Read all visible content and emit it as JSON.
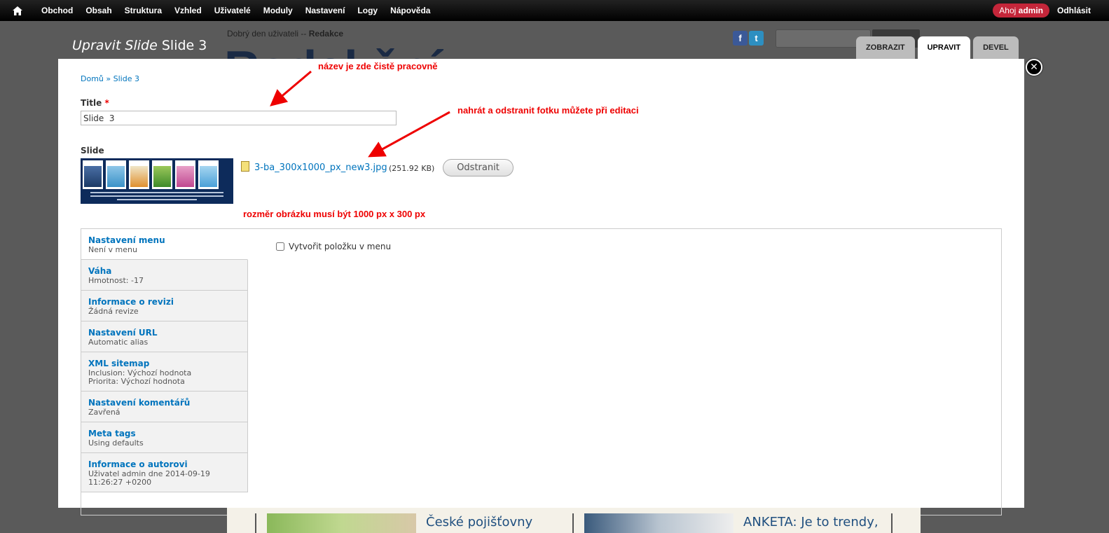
{
  "toolbar": {
    "menu": [
      "Obchod",
      "Obsah",
      "Struktura",
      "Vzhled",
      "Uživatelé",
      "Moduly",
      "Nastavení",
      "Logy",
      "Nápověda"
    ],
    "hello_prefix": "Ahoj",
    "hello_user": "admin",
    "logout": "Odhlásit"
  },
  "background_page": {
    "greeting_prefix": "Dobrý den uživateli --",
    "greeting_user": "Redakce",
    "big_text": "Redakční",
    "bottom_headlines": [
      "České pojišťovny",
      "ANKETA: Je to trendy,"
    ]
  },
  "overlay": {
    "title_italic": "Upravit Slide",
    "title_rest": "Slide 3",
    "tabs": [
      "ZOBRAZIT",
      "UPRAVIT",
      "DEVEL"
    ],
    "breadcrumb": {
      "home": "Domů",
      "separator": "»",
      "current": "Slide 3"
    },
    "title_label": "Title",
    "required_mark": "*",
    "title_value": "Slide  3",
    "slide_label": "Slide",
    "file_name": "3-ba_300x1000_px_new3.jpg",
    "file_size": "(251.92 KB)",
    "remove_button": "Odstranit",
    "vertical_tabs": [
      {
        "title": "Nastavení menu",
        "summary": "Není v menu"
      },
      {
        "title": "Váha",
        "summary": "Hmotnost: -17"
      },
      {
        "title": "Informace o revizi",
        "summary": "Žádná revize"
      },
      {
        "title": "Nastavení URL",
        "summary": "Automatic alias"
      },
      {
        "title": "XML sitemap",
        "summary": "Inclusion: Výchozí hodnota",
        "summary2": "Priorita: Výchozí hodnota"
      },
      {
        "title": "Nastavení komentářů",
        "summary": "Zavřená"
      },
      {
        "title": "Meta tags",
        "summary": "Using defaults"
      },
      {
        "title": "Informace o autorovi",
        "summary": "Uživatel admin dne 2014-09-19",
        "summary2": "11:26:27 +0200"
      }
    ],
    "menu_checkbox_label": "Vytvořit položku v menu"
  },
  "annotations": {
    "name_note": "název je zde čistě pracovně",
    "photo_note": "nahrát a odstranit fotku můžete při editaci",
    "size_note": "rozměr obrázku musí být 1000 px x 300 px"
  },
  "colors": {
    "link": "#0074bd",
    "annotation": "#e00000",
    "hello_badge": "#c4263a"
  }
}
